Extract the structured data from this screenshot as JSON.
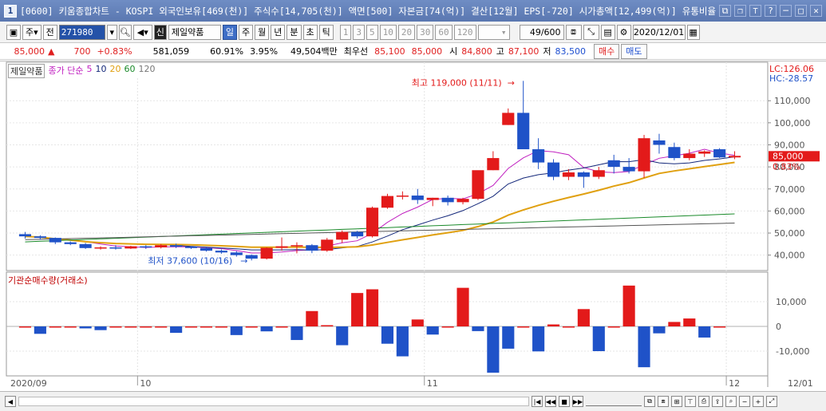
{
  "window": {
    "title": "[0600] 키움종합차트 - KOSPI 외국인보유[469(천)] 주식수[14,705(천)] 액면[500] 자본금[74(억)] 결산[12월] EPS[-720] 시가총액[12,499(억)] 유통비율",
    "app_number": "1"
  },
  "toolbar": {
    "market_type": "주",
    "prev_label": "전",
    "code": "271980",
    "stock_name": "제일약품",
    "new_badge": "신",
    "periods": [
      "일",
      "주",
      "월",
      "년",
      "분",
      "초",
      "틱"
    ],
    "active_period": "일",
    "intervals": [
      "1",
      "3",
      "5",
      "10",
      "20",
      "30",
      "60",
      "120"
    ],
    "count": "49/600",
    "date": "2020/12/01"
  },
  "quote": {
    "price": "85,000",
    "change_arrow": "▲",
    "change": "700",
    "change_pct": "+0.83%",
    "volume": "581,059",
    "ratio1": "60.91%",
    "ratio2": "3.95%",
    "amount": "49,504백만",
    "best_ask_label": "최우선",
    "best_ask": "85,100",
    "best_bid": "85,000",
    "open_label": "시",
    "open": "84,800",
    "high_label": "고",
    "high": "87,100",
    "low_label": "저",
    "low": "83,500",
    "buy_button": "매수",
    "sell_button": "매도"
  },
  "price_panel": {
    "legend_name": "제일약품",
    "legend_ma": "종가 단순",
    "ma_periods": [
      "5",
      "10",
      "20",
      "60",
      "120"
    ],
    "high_annotation": "최고 119,000 (11/11)",
    "low_annotation": "최저 37,600 (10/16)",
    "lc_label": "LC:126.06",
    "hc_label": "HC:-28.57",
    "current_price": "85,000",
    "current_pct": "0.83%",
    "y_ticks": [
      "110,000",
      "100,000",
      "90,000",
      "80,000",
      "70,000",
      "60,000",
      "50,000",
      "40,000"
    ]
  },
  "volume_panel": {
    "title": "기관순매수량(거래소)",
    "y_ticks": [
      "10,000",
      "0",
      "-10,000"
    ]
  },
  "x_axis": {
    "labels": [
      "2020/09",
      "10",
      "11",
      "12",
      "12/01"
    ]
  },
  "colors": {
    "up": "#e31a1a",
    "down": "#1f52c8",
    "ma5": "#c020c0",
    "ma10": "#14287a",
    "ma20": "#e0a010",
    "ma60": "#1a8a2a",
    "ma120": "#555555"
  },
  "chart_data": {
    "type": "candlestick",
    "unit": "KRW",
    "ohlc": [
      [
        49500,
        50500,
        47500,
        48500
      ],
      [
        48500,
        49000,
        47000,
        47800
      ],
      [
        47800,
        48000,
        45000,
        45800
      ],
      [
        45800,
        46200,
        44500,
        45000
      ],
      [
        45000,
        45500,
        42800,
        43200
      ],
      [
        43200,
        44000,
        42500,
        43500
      ],
      [
        43500,
        44500,
        42500,
        43000
      ],
      [
        43000,
        44200,
        42800,
        44000
      ],
      [
        44000,
        44500,
        42800,
        43500
      ],
      [
        43500,
        45000,
        43000,
        44500
      ],
      [
        44500,
        45200,
        43200,
        43800
      ],
      [
        43800,
        44000,
        42800,
        43200
      ],
      [
        43200,
        43800,
        41600,
        42000
      ],
      [
        42000,
        42600,
        40600,
        41200
      ],
      [
        41200,
        41800,
        39300,
        40000
      ],
      [
        40000,
        40300,
        37600,
        38400
      ],
      [
        38400,
        43500,
        38000,
        43300
      ],
      [
        43300,
        48000,
        42000,
        44000
      ],
      [
        44000,
        45800,
        40800,
        44500
      ],
      [
        44500,
        45000,
        40900,
        42000
      ],
      [
        42000,
        47800,
        41500,
        47000
      ],
      [
        47000,
        51200,
        45500,
        50500
      ],
      [
        50500,
        51000,
        47600,
        48500
      ],
      [
        48500,
        62000,
        48000,
        61500
      ],
      [
        61500,
        67800,
        61000,
        66800
      ],
      [
        66800,
        68900,
        65200,
        67000
      ],
      [
        67000,
        70000,
        63200,
        65000
      ],
      [
        65000,
        66000,
        62200,
        66000
      ],
      [
        66000,
        67000,
        62500,
        64000
      ],
      [
        64000,
        66000,
        63000,
        65500
      ],
      [
        65500,
        78000,
        65000,
        78500
      ],
      [
        78500,
        87100,
        78500,
        84000
      ],
      [
        99000,
        106500,
        99000,
        104500
      ],
      [
        104500,
        119000,
        88000,
        88000
      ],
      [
        88000,
        93000,
        79000,
        82000
      ],
      [
        82000,
        83500,
        74000,
        75500
      ],
      [
        75500,
        79000,
        74000,
        77500
      ],
      [
        77500,
        78000,
        70500,
        75500
      ],
      [
        75500,
        80000,
        74500,
        78500
      ],
      [
        83000,
        85500,
        77000,
        80000
      ],
      [
        80000,
        84000,
        77000,
        78000
      ],
      [
        78000,
        94500,
        75000,
        93000
      ],
      [
        92000,
        95000,
        86000,
        90000
      ],
      [
        89000,
        91000,
        83000,
        84000
      ],
      [
        84000,
        88000,
        83000,
        86000
      ],
      [
        86000,
        87500,
        84500,
        87000
      ],
      [
        88000,
        88500,
        84000,
        84300
      ],
      [
        84300,
        87100,
        83500,
        85000
      ]
    ],
    "institutional_net_buy": [
      0,
      -3000,
      0,
      0,
      -800,
      -1500,
      0,
      0,
      0,
      0,
      -2600,
      0,
      0,
      0,
      -3500,
      0,
      -2000,
      0,
      -5500,
      6200,
      500,
      -7600,
      13500,
      15000,
      -7000,
      -12100,
      2800,
      -3300,
      0,
      15600,
      -1900,
      -18700,
      -9000,
      0,
      -10100,
      800,
      0,
      7000,
      -10000,
      0,
      16500,
      -16500,
      -2800,
      1800,
      3200,
      -4500,
      0
    ],
    "x_axis_labels": [
      "2020/09",
      "10",
      "11",
      "12"
    ],
    "y_range": [
      33000,
      126000
    ],
    "high": {
      "value": 119000,
      "date": "11/11"
    },
    "low": {
      "value": 37600,
      "date": "10/16"
    }
  }
}
